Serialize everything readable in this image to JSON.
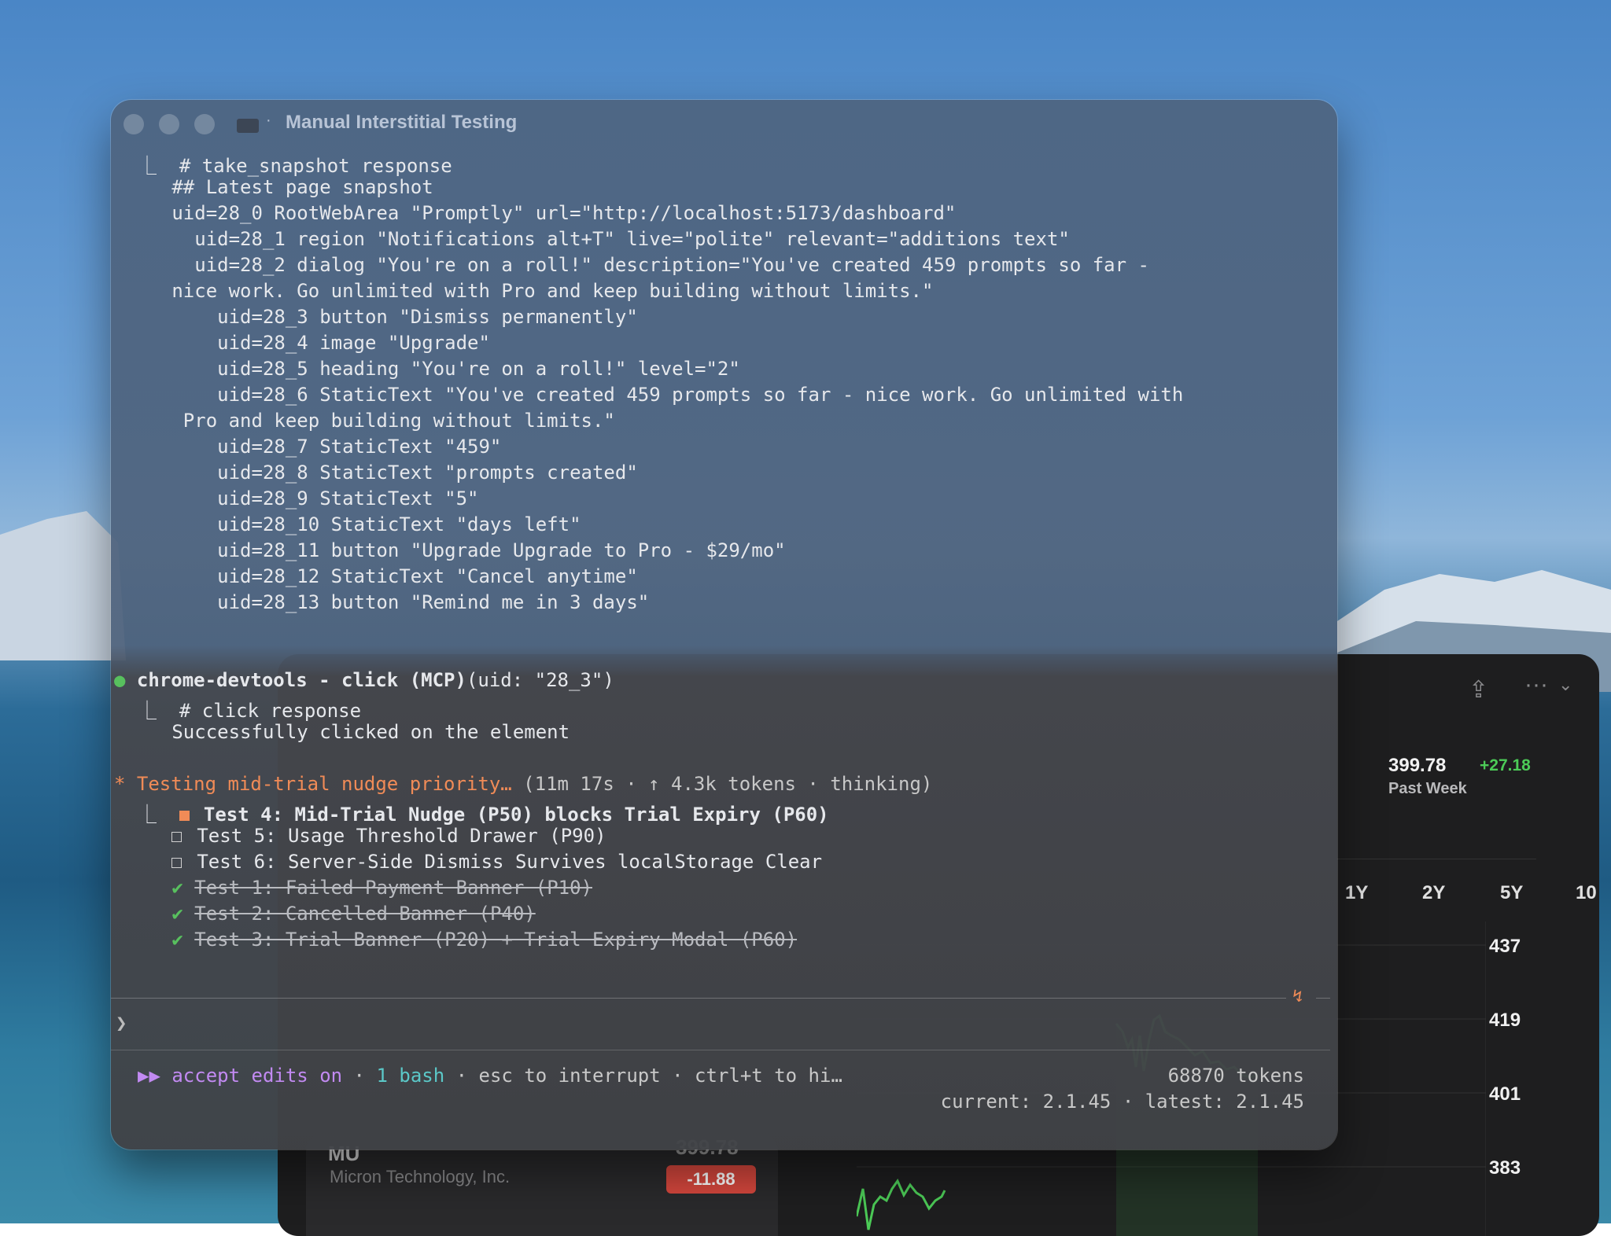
{
  "terminal": {
    "title": "Manual Interstitial Testing",
    "title_sep": "·",
    "snapshot_lines": [
      "⎿  # take_snapshot response",
      "   ## Latest page snapshot",
      "   uid=28_0 RootWebArea \"Promptly\" url=\"http://localhost:5173/dashboard\"",
      "     uid=28_1 region \"Notifications alt+T\" live=\"polite\" relevant=\"additions text\"",
      "     uid=28_2 dialog \"You're on a roll!\" description=\"You've created 459 prompts so far -",
      "   nice work. Go unlimited with Pro and keep building without limits.\"",
      "       uid=28_3 button \"Dismiss permanently\"",
      "       uid=28_4 image \"Upgrade\"",
      "       uid=28_5 heading \"You're on a roll!\" level=\"2\"",
      "       uid=28_6 StaticText \"You've created 459 prompts so far - nice work. Go unlimited with",
      "    Pro and keep building without limits.\"",
      "       uid=28_7 StaticText \"459\"",
      "       uid=28_8 StaticText \"prompts created\"",
      "       uid=28_9 StaticText \"5\"",
      "       uid=28_10 StaticText \"days left\"",
      "       uid=28_11 button \"Upgrade Upgrade to Pro - $29/mo\"",
      "       uid=28_12 StaticText \"Cancel anytime\"",
      "       uid=28_13 button \"Remind me in 3 days\""
    ],
    "tool_call": {
      "bullet": "●",
      "name": "chrome-devtools - click (MCP)",
      "args": "(uid: \"28_3\")",
      "response_header": "⎿  # click response",
      "response_body": "   Successfully clicked on the element"
    },
    "status": {
      "star": "*",
      "label": "Testing mid-trial nudge priority…",
      "meta": " (11m 17s · ↑ 4.3k tokens · thinking)"
    },
    "tasks": [
      {
        "prefix": "⎿  ",
        "text": "Test 4: Mid-Trial Nudge (P50) blocks Trial Expiry (P60)",
        "state": "in_progress"
      },
      {
        "prefix": "   ",
        "text": "Test 5: Usage Threshold Drawer (P90)",
        "state": "pending"
      },
      {
        "prefix": "   ",
        "text": "Test 6: Server-Side Dismiss Survives localStorage Clear",
        "state": "pending"
      },
      {
        "prefix": "   ",
        "text": "Test 1: Failed Payment Banner (P10)",
        "state": "done",
        "check": "✔"
      },
      {
        "prefix": "   ",
        "text": "Test 2: Cancelled Banner (P40)",
        "state": "done",
        "check": "✔"
      },
      {
        "prefix": "   ",
        "text": "Test 3: Trial Banner (P20) + Trial Expiry Modal (P60)",
        "state": "done",
        "check": "✔"
      }
    ],
    "bolt": "↯",
    "prompt_char": "❯",
    "footer": {
      "arrows": "▶▶",
      "mode": "accept edits on",
      "dot": " · ",
      "bash": "1 bash",
      "hint": " · esc to interrupt · ctrl+t to hi…",
      "tokens": "68870 tokens",
      "version": "current: 2.1.45 · latest: 2.1.45"
    }
  },
  "stocks": {
    "price": "399.78",
    "change": "+27.18",
    "period": "Past Week",
    "ranges": [
      "1Y",
      "2Y",
      "5Y",
      "10"
    ],
    "y_ticks": [
      "437",
      "419",
      "401",
      "383"
    ],
    "ticker": "MU",
    "company": "Micron Technology, Inc.",
    "row_price": "399.78",
    "row_change": "-11.88",
    "colors": {
      "up": "#4ccb57",
      "down": "#d5473d"
    },
    "chart_data": {
      "type": "line",
      "y_ticks": [
        437,
        419,
        401,
        383
      ],
      "ylim": [
        383,
        437
      ]
    }
  }
}
